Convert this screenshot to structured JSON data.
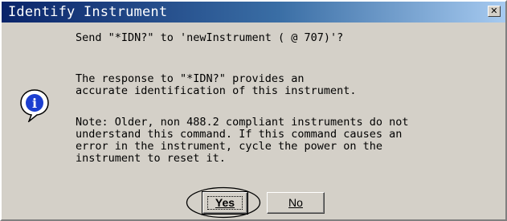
{
  "window": {
    "title": "Identify Instrument",
    "close_icon": "close-icon"
  },
  "dialog": {
    "icon": "info-icon",
    "icon_glyph": "i",
    "message_1": "Send \"*IDN?\" to 'newInstrument ( @ 707)'?",
    "message_2": "The response to \"*IDN?\" provides an\naccurate identification of this instrument.",
    "message_3": "Note: Older, non 488.2 compliant instruments do not\nunderstand this command. If this command causes an\nerror in the instrument, cycle the power on the\ninstrument to reset it."
  },
  "buttons": {
    "yes_label": "Yes",
    "no_label": "No"
  },
  "colors": {
    "titlebar_start": "#0a246a",
    "titlebar_end": "#a6caf0",
    "face": "#d4d0c8",
    "annotation_circle": "#000000"
  }
}
